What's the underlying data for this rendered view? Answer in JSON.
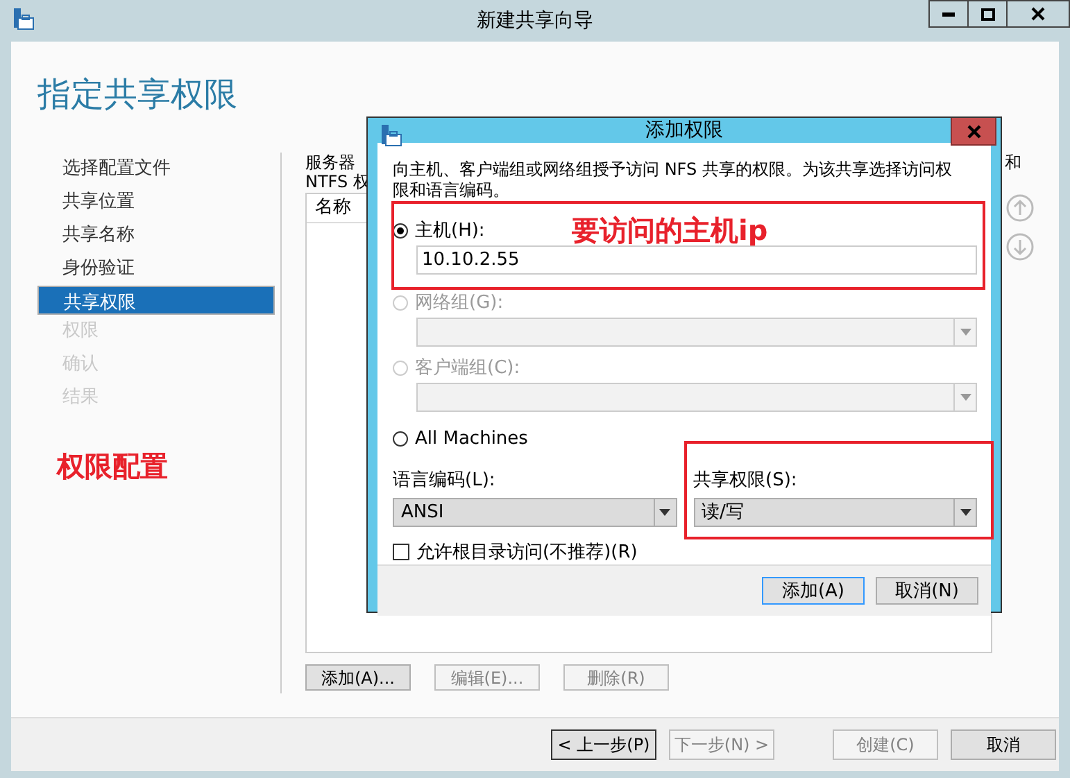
{
  "window": {
    "title": "新建共享向导"
  },
  "heading": "指定共享权限",
  "nav": [
    {
      "label": "选择配置文件",
      "selected": false,
      "disabled": false
    },
    {
      "label": "共享位置",
      "selected": false,
      "disabled": false
    },
    {
      "label": "共享名称",
      "selected": false,
      "disabled": false
    },
    {
      "label": "身份验证",
      "selected": false,
      "disabled": false
    },
    {
      "label": "共享权限",
      "selected": true,
      "disabled": false
    },
    {
      "label": "权限",
      "selected": false,
      "disabled": true
    },
    {
      "label": "确认",
      "selected": false,
      "disabled": true
    },
    {
      "label": "结果",
      "selected": false,
      "disabled": true
    }
  ],
  "description": {
    "line_1_left": "服务器",
    "line_1_right": "和",
    "line_2_left": "NTFS 权"
  },
  "table": {
    "columns": [
      "名称"
    ]
  },
  "table_buttons": [
    {
      "label": "添加(A)...",
      "disabled": false
    },
    {
      "label": "编辑(E)...",
      "disabled": true
    },
    {
      "label": "删除(R)",
      "disabled": true
    }
  ],
  "footer_buttons": [
    {
      "label": "< 上一步(P)",
      "disabled": false,
      "focused": true
    },
    {
      "label": "下一步(N) >",
      "disabled": true,
      "focused": false
    },
    {
      "label": "创建(C)",
      "disabled": true,
      "focused": false
    },
    {
      "label": "取消",
      "disabled": false,
      "focused": false
    }
  ],
  "dialog": {
    "title": "添加权限",
    "description": "向主机、客户端组或网络组授予访问 NFS 共享的权限。为该共享选择访问权限和语言编码。",
    "options": [
      {
        "kind": "input",
        "label": "主机(H):",
        "selected": true,
        "disabled": false,
        "value": "10.10.2.55"
      },
      {
        "kind": "combo",
        "label": "网络组(G):",
        "selected": false,
        "disabled": true
      },
      {
        "kind": "combo",
        "label": "客户端组(C):",
        "selected": false,
        "disabled": true
      },
      {
        "kind": "plain",
        "label": "All Machines",
        "selected": false,
        "disabled": false
      }
    ],
    "encoding": {
      "label": "语言编码(L):",
      "value": "ANSI"
    },
    "permission": {
      "label": "共享权限(S):",
      "value": "读/写"
    },
    "root_access": {
      "label": "允许根目录访问(不推荐)(R)",
      "checked": false
    },
    "buttons": [
      {
        "label": "添加(A)",
        "default": true
      },
      {
        "label": "取消(N)",
        "default": false
      }
    ]
  },
  "annotations": [
    {
      "kind": "box",
      "text": "要访问的主机ip"
    },
    {
      "kind": "box"
    },
    {
      "kind": "label",
      "text": "权限配置"
    }
  ]
}
